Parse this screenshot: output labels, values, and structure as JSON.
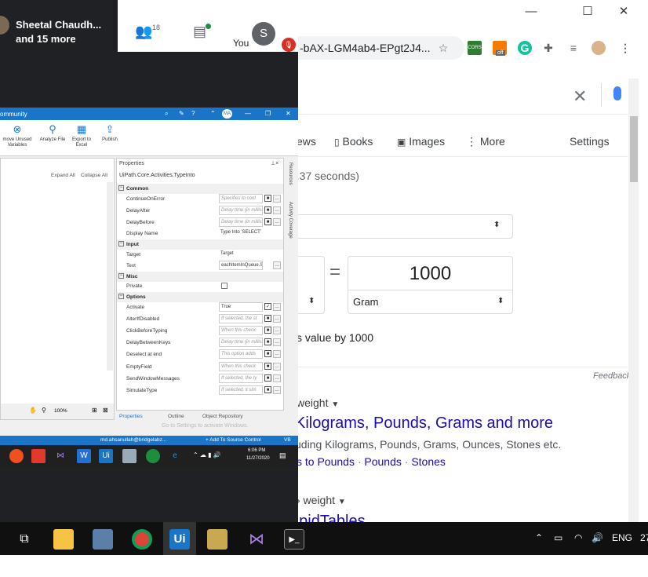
{
  "chrome": {
    "url": "-bAX-LGM4ab4-EPgt2J4...",
    "ext_badge": "off",
    "search_clear": "✕",
    "tabs": [
      "ews",
      "Books",
      "Images",
      "More",
      "Settings"
    ],
    "results_stats": "0.37 seconds)",
    "equals": "=",
    "to_value": "1000",
    "to_unit": "Gram",
    "formula": "s value by 1000",
    "feedback": "Feedback",
    "result1_breadcrumb": "weight",
    "result1_title": "Kilograms, Pounds, Grams and more",
    "result1_snippet": "uding Kilograms, Pounds, Grams, Ounces, Stones etc.",
    "result1_links": [
      "s to Pounds",
      "Pounds",
      "Stones"
    ],
    "result2_breadcrumb": "› weight",
    "result2_title_partial": "apidTables"
  },
  "meet": {
    "presenter": "Sheetal Chaudh...",
    "presenter_more": "and 15 more",
    "participants_count": "18",
    "you_label": "You",
    "avatar_letter": "S"
  },
  "uipath": {
    "title": "ommunity",
    "avatar": "MA",
    "ribbon": [
      {
        "icon": "remove-unused-icon",
        "label": "move Unused Variables"
      },
      {
        "icon": "analyze-file-icon",
        "label": "Analyze File"
      },
      {
        "icon": "export-excel-icon",
        "label": "Export to Excel"
      },
      {
        "icon": "publish-icon",
        "label": "Publish"
      }
    ],
    "expand_all": "Expand All",
    "collapse_all": "Collapse All",
    "properties_header": "Properties",
    "activity_type": "UiPath.Core.Activities.TypeInto",
    "sections": {
      "common": "Common",
      "input": "Input",
      "misc": "Misc",
      "options": "Options"
    },
    "props": {
      "continue_on_error": {
        "label": "ContinueOnError",
        "value": "Specifies to cont"
      },
      "delay_after": {
        "label": "DelayAfter",
        "value": "Delay time (in millis"
      },
      "delay_before": {
        "label": "DelayBefore",
        "value": "Delay time (in millis"
      },
      "display_name": {
        "label": "Display Name",
        "value": "Type Into 'SELECT'"
      },
      "target": {
        "label": "Target",
        "value": "Target"
      },
      "text": {
        "label": "Text",
        "value": "eachItemInQueue.S"
      },
      "private": {
        "label": "Private",
        "value": ""
      },
      "activate": {
        "label": "Activate",
        "value": "True"
      },
      "alter_if_disabled": {
        "label": "AlterIfDisabled",
        "value": "If selected, the st"
      },
      "click_before_typing": {
        "label": "ClickBeforeTyping",
        "value": "When this check"
      },
      "delay_between_keys": {
        "label": "DelayBetweenKeys",
        "value": "Delay time (in millis"
      },
      "deselect_at_end": {
        "label": "Deselect at end",
        "value": "This option adds"
      },
      "empty_field": {
        "label": "EmptyField",
        "value": "When this check"
      },
      "send_window_messages": {
        "label": "SendWindowMessages",
        "value": "If selected, the ty"
      },
      "simulate_type": {
        "label": "SimulateType",
        "value": "If selected, it sim"
      }
    },
    "side_tabs": [
      "Resources",
      "Activity Coverage"
    ],
    "zoom": "100%",
    "bottom_tabs": [
      "Properties",
      "Outline",
      "Object Repository"
    ],
    "activate_windows": "Go to Settings to activate Windows.",
    "status_user": "md.ahsanullah@bridgelabz...",
    "status_source": "+ Add To Source Control",
    "status_lang": "VB",
    "time": "6:06 PM",
    "date": "11/27/2020"
  },
  "taskbar": {
    "lang": "ENG",
    "clock_partial": "27"
  }
}
